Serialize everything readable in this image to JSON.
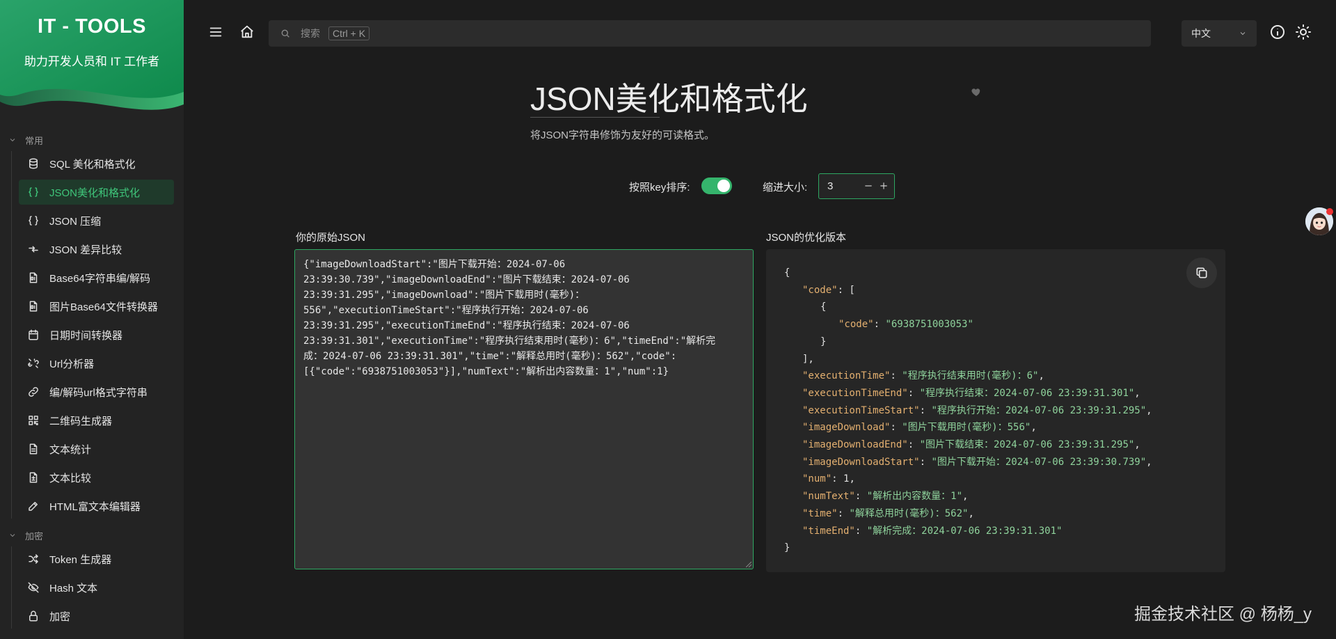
{
  "brand": {
    "title": "IT - TOOLS",
    "subtitle": "助力开发人员和 IT 工作者"
  },
  "sidebar": {
    "groups": [
      {
        "label": "常用",
        "items": [
          {
            "label": "SQL 美化和格式化",
            "icon": "database-icon"
          },
          {
            "label": "JSON美化和格式化",
            "icon": "braces-icon",
            "active": true
          },
          {
            "label": "JSON 压缩",
            "icon": "braces-icon"
          },
          {
            "label": "JSON 差异比较",
            "icon": "compare-arrows-icon"
          },
          {
            "label": "Base64字符串编/解码",
            "icon": "file-binary-icon"
          },
          {
            "label": "图片Base64文件转换器",
            "icon": "file-binary-icon"
          },
          {
            "label": "日期时间转换器",
            "icon": "calendar-icon"
          },
          {
            "label": "Url分析器",
            "icon": "unlink-icon"
          },
          {
            "label": "编/解码url格式字符串",
            "icon": "link-icon"
          },
          {
            "label": "二维码生成器",
            "icon": "qrcode-icon"
          },
          {
            "label": "文本统计",
            "icon": "file-text-icon"
          },
          {
            "label": "文本比较",
            "icon": "file-diff-icon"
          },
          {
            "label": "HTML富文本编辑器",
            "icon": "edit-icon"
          }
        ]
      },
      {
        "label": "加密",
        "items": [
          {
            "label": "Token 生成器",
            "icon": "shuffle-icon"
          },
          {
            "label": "Hash 文本",
            "icon": "eye-off-icon"
          },
          {
            "label": "加密",
            "icon": "lock-icon"
          }
        ]
      }
    ]
  },
  "topbar": {
    "search_placeholder": "搜索",
    "search_shortcut": "Ctrl + K",
    "language": "中文"
  },
  "main": {
    "title": "JSON美化和格式化",
    "description": "将JSON字符串修饰为友好的可读格式。",
    "sort_label": "按照key排序:",
    "sort_enabled": true,
    "indent_label": "缩进大小:",
    "indent_value": "3",
    "input_label": "你的原始JSON",
    "output_label": "JSON的优化版本"
  },
  "input_lines": [
    "{\"imageDownloadStart\":\"图片下载开始：2024-07-06",
    "23:39:30.739\",\"imageDownloadEnd\":\"图片下载结束：2024-07-06",
    "23:39:31.295\",\"imageDownload\":\"图片下载用时(毫秒)：",
    "556\",\"executionTimeStart\":\"程序执行开始：2024-07-06",
    "23:39:31.295\",\"executionTimeEnd\":\"程序执行结束：2024-07-06",
    "23:39:31.301\",\"executionTime\":\"程序执行结束用时(毫秒)：6\",\"timeEnd\":\"解析完",
    "成：2024-07-06 23:39:31.301\",\"time\":\"解释总用时(毫秒)：562\",\"code\":",
    "[{\"code\":\"6938751003053\"}],\"numText\":\"解析出内容数量：1\",\"num\":1}"
  ],
  "output_lines": [
    {
      "indent": 0,
      "pre": "{"
    },
    {
      "indent": 1,
      "key": "\"code\"",
      "sep": ": ["
    },
    {
      "indent": 2,
      "pre": "{"
    },
    {
      "indent": 3,
      "key": "\"code\"",
      "sep": ": ",
      "str": "\"6938751003053\""
    },
    {
      "indent": 2,
      "pre": "}"
    },
    {
      "indent": 1,
      "pre": "],"
    },
    {
      "indent": 1,
      "key": "\"executionTime\"",
      "sep": ": ",
      "str": "\"程序执行结束用时(毫秒)：6\"",
      "post": ","
    },
    {
      "indent": 1,
      "key": "\"executionTimeEnd\"",
      "sep": ": ",
      "str": "\"程序执行结束：2024-07-06 23:39:31.301\"",
      "post": ","
    },
    {
      "indent": 1,
      "key": "\"executionTimeStart\"",
      "sep": ": ",
      "str": "\"程序执行开始：2024-07-06 23:39:31.295\"",
      "post": ","
    },
    {
      "indent": 1,
      "key": "\"imageDownload\"",
      "sep": ": ",
      "str": "\"图片下载用时(毫秒)：556\"",
      "post": ","
    },
    {
      "indent": 1,
      "key": "\"imageDownloadEnd\"",
      "sep": ": ",
      "str": "\"图片下载结束：2024-07-06 23:39:31.295\"",
      "post": ","
    },
    {
      "indent": 1,
      "key": "\"imageDownloadStart\"",
      "sep": ": ",
      "str": "\"图片下载开始：2024-07-06 23:39:30.739\"",
      "post": ","
    },
    {
      "indent": 1,
      "key": "\"num\"",
      "sep": ": ",
      "num": "1",
      "post": ","
    },
    {
      "indent": 1,
      "key": "\"numText\"",
      "sep": ": ",
      "str": "\"解析出内容数量：1\"",
      "post": ","
    },
    {
      "indent": 1,
      "key": "\"time\"",
      "sep": ": ",
      "str": "\"解释总用时(毫秒)：562\"",
      "post": ","
    },
    {
      "indent": 1,
      "key": "\"timeEnd\"",
      "sep": ": ",
      "str": "\"解析完成：2024-07-06 23:39:31.301\""
    },
    {
      "indent": 0,
      "pre": "}"
    }
  ],
  "watermark": "掘金技术社区 @ 杨杨_y",
  "colors": {
    "accent": "#35b46c",
    "json_key": "#e4b070",
    "json_string": "#8fd39c"
  }
}
